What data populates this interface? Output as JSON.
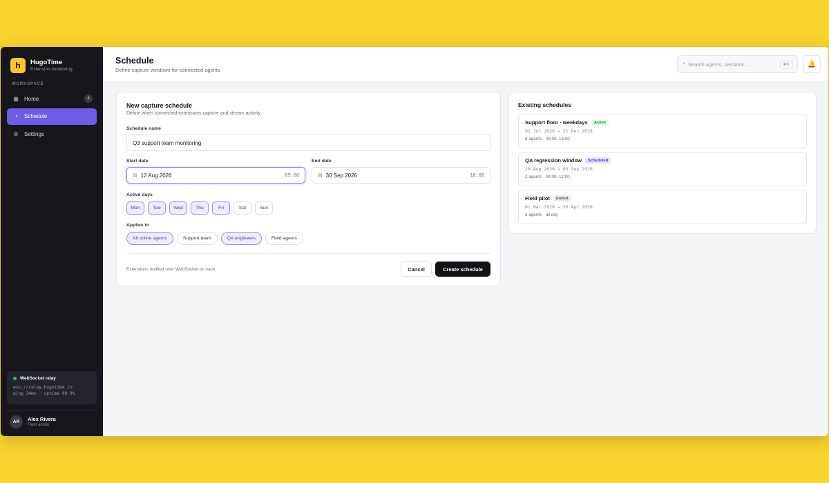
{
  "brand": {
    "logo_letter": "h",
    "name": "HugoTime",
    "subtitle": "Extension monitoring",
    "accent": "#6d5ce6"
  },
  "sidebar": {
    "section_label": "WORKSPACE",
    "items": [
      {
        "label": "Home",
        "icon": "grid-icon",
        "badge": "4",
        "active": false
      },
      {
        "label": "Schedule",
        "icon": "clock-icon",
        "active": true
      },
      {
        "label": "Settings",
        "icon": "gear-icon",
        "active": false
      }
    ],
    "relay": {
      "title": "WebSocket relay",
      "url": "wss://relay.hugotime.io",
      "stats": "ping 34ms · uptime 99.9%",
      "status_color": "#22c55e"
    },
    "user": {
      "initials": "AR",
      "name": "Alex Rivera",
      "role": "Fleet admin"
    }
  },
  "header": {
    "title": "Schedule",
    "subtitle": "Define capture windows for connected agents",
    "search_placeholder": "Search agents, sessions…",
    "search_shortcut": "⌘K"
  },
  "form": {
    "title": "New capture schedule",
    "subtitle": "Define when connected extensions capture and stream activity.",
    "name_label": "Schedule name",
    "name_value": "Q3 support team monitoring",
    "start_label": "Start date",
    "start_date": "12 Aug 2026",
    "start_time": "09:00",
    "end_label": "End date",
    "end_date": "30 Sep 2026",
    "end_time": "18:00",
    "days_label": "Active days",
    "days": [
      {
        "label": "Mon",
        "on": true
      },
      {
        "label": "Tue",
        "on": true
      },
      {
        "label": "Wed",
        "on": true
      },
      {
        "label": "Thu",
        "on": true
      },
      {
        "label": "Fri",
        "on": true
      },
      {
        "label": "Sat",
        "on": false
      },
      {
        "label": "Sun",
        "on": false
      }
    ],
    "applies_label": "Applies to",
    "targets": [
      {
        "label": "All online agents",
        "on": true
      },
      {
        "label": "Support team",
        "on": false
      },
      {
        "label": "QA engineers",
        "on": true
      },
      {
        "label": "Field agents",
        "on": false
      }
    ],
    "footer_note": "Extensions notified over WebSocket on save.",
    "cancel_label": "Cancel",
    "create_label": "Create schedule"
  },
  "existing": {
    "title": "Existing schedules",
    "items": [
      {
        "name": "Support floor · weekdays",
        "status": "Active",
        "range": "01 Jul 2026 → 31 Dec 2026",
        "meta": "8 agents · 09:00–18:00"
      },
      {
        "name": "QA regression window",
        "status": "Scheduled",
        "range": "20 Aug 2026 → 05 Sep 2026",
        "meta": "2 agents · 08:00–12:00"
      },
      {
        "name": "Field pilot",
        "status": "Ended",
        "range": "01 Mar 2026 → 30 Apr 2026",
        "meta": "3 agents · all day"
      }
    ]
  }
}
